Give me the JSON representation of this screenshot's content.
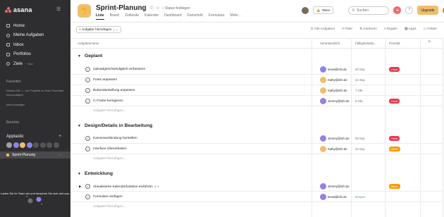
{
  "sidebar": {
    "logo_text": "asana",
    "nav": [
      {
        "label": "Home",
        "icon": "home-icon"
      },
      {
        "label": "Meine Aufgaben",
        "icon": "check-circle-icon"
      },
      {
        "label": "Inbox",
        "icon": "bell-icon"
      },
      {
        "label": "Portfolios",
        "icon": "bar-chart-icon"
      },
      {
        "label": "Ziele",
        "icon": "person-icon",
        "badge": "Neu!"
      }
    ],
    "favorites_title": "Favoriten",
    "favorites_text": "Klicken Sie ☆, um Projekte zu Ihren Favoriten hinzuzufügen",
    "more": "Mehr anzeigen",
    "reports": "Berichte",
    "team": "Apptastic",
    "project": "Sprint-Planung",
    "promo": "Laden Sie Ihr Team ein und tauschen Sie sich dort aus."
  },
  "header": {
    "title": "Sprint-Planung",
    "status": "Status festlegen",
    "tabs": [
      "Liste",
      "Board",
      "Zeitleiste",
      "Kalender",
      "Dashboard",
      "Fortschritt",
      "Formulare",
      "Mehr..."
    ],
    "share": "Teilen",
    "search_placeholder": "Suchen",
    "upgrade": "Upgrade",
    "help": "?"
  },
  "toolbar": {
    "add": "+ Aufgabe hinzufügen",
    "tools": [
      "Alle Aufgaben",
      "Filter",
      "Sortieren",
      "Regeln",
      "Apps",
      "Felder"
    ]
  },
  "columns": {
    "name": "Aufgabenname",
    "assignee": "Verantwortlich",
    "due": "Fälligkeitsdat...",
    "priority": "Priorität"
  },
  "sections": [
    {
      "title": "Geplant",
      "add": "Aufgabe hinzufügen...",
      "tasks": [
        {
          "name": "Uploadgeschwindigkeit verbessern",
          "assignee": "tesus@info.de",
          "due": "30 Sep.",
          "priority": "Hoch"
        },
        {
          "name": "Fonts anpassen",
          "assignee": "Kathy@info.de",
          "due": "24 Sep.",
          "priority": ""
        },
        {
          "name": "Buttondarstellung anpassen",
          "assignee": "Kathy@info.de",
          "due": "7 Okt.",
          "priority": ""
        },
        {
          "name": "CI Farbe korrigieren",
          "assignee": "Jeremy@info.de",
          "due": "5 Okt.",
          "priority": "Hoch"
        }
      ]
    },
    {
      "title": "Design/Details in Bearbeitung",
      "add": "Aufgabe hinzufügen...",
      "tasks": [
        {
          "name": "Kameraverbindung herstellen",
          "assignee": "Jeremy@info.de",
          "due": "28 Sep.",
          "priority": "Hoch"
        },
        {
          "name": "Interface Überarbeiten",
          "assignee": "Kathy@info.de",
          "due": "22 Sep.",
          "priority": "Mittel"
        }
      ]
    },
    {
      "title": "Entwicklung",
      "add": "Aufgabe hinzufügen...",
      "tasks": [
        {
          "name": "Aktualisierte Kalenderfunktion einführen",
          "subtasks": "1 ⑂",
          "assignee": "Jeremy@info.de",
          "due": "",
          "priority": "Mittel"
        },
        {
          "name": "Formulare einfügen",
          "assignee": "tesus@info.de",
          "due": "Morgen",
          "priority": ""
        }
      ]
    }
  ],
  "colors": {
    "high": "#e8384f",
    "medium": "#fd9a00",
    "accent": "#f06a6a"
  }
}
